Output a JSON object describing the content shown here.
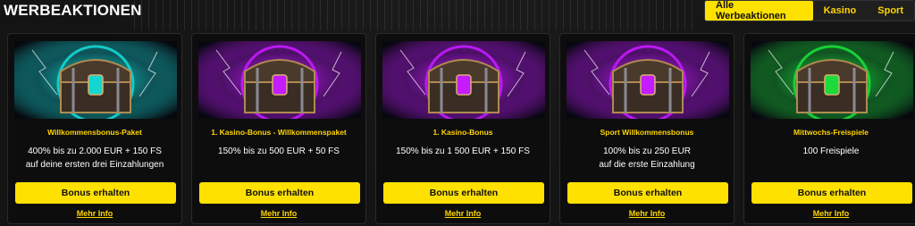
{
  "header": {
    "title": "WERBEAKTIONEN"
  },
  "filters": [
    {
      "label": "Alle Werbeaktionen",
      "active": true
    },
    {
      "label": "Kasino",
      "active": false
    },
    {
      "label": "Sport",
      "active": false
    }
  ],
  "colors": {
    "accent": "#ffe100",
    "accent_text": "#ffd400",
    "card_bg": "#0d0d0d",
    "page_bg": "#141414"
  },
  "cards": [
    {
      "subtitle": "Willkommensbonus-Paket",
      "desc_line1": "400% bis zu 2.000 EUR + 150 FS",
      "desc_line2": "auf deine ersten drei Einzahlungen",
      "button": "Bonus erhalten",
      "link": "Mehr Info",
      "image": "teal-treasure-chest",
      "glow": "#14d6d0"
    },
    {
      "subtitle": "1. Kasino-Bonus - Willkommenspaket",
      "desc_line1": "150% bis zu 500 EUR + 50 FS",
      "desc_line2": "",
      "button": "Bonus erhalten",
      "link": "Mehr Info",
      "image": "purple-treasure-chest",
      "glow": "#c51bff"
    },
    {
      "subtitle": "1. Kasino-Bonus",
      "desc_line1": "150% bis zu 1 500 EUR + 150 FS",
      "desc_line2": "",
      "button": "Bonus erhalten",
      "link": "Mehr Info",
      "image": "purple-treasure-chest",
      "glow": "#c51bff"
    },
    {
      "subtitle": "Sport Willkommensbonus",
      "desc_line1": "100% bis zu 250 EUR",
      "desc_line2": "auf die erste Einzahlung",
      "button": "Bonus erhalten",
      "link": "Mehr Info",
      "image": "purple-treasure-chest",
      "glow": "#c51bff"
    },
    {
      "subtitle": "Mittwochs-Freispiele",
      "desc_line1": "100 Freispiele",
      "desc_line2": "",
      "button": "Bonus erhalten",
      "link": "Mehr Info",
      "image": "green-treasure-chest",
      "glow": "#1bdc3a"
    }
  ]
}
